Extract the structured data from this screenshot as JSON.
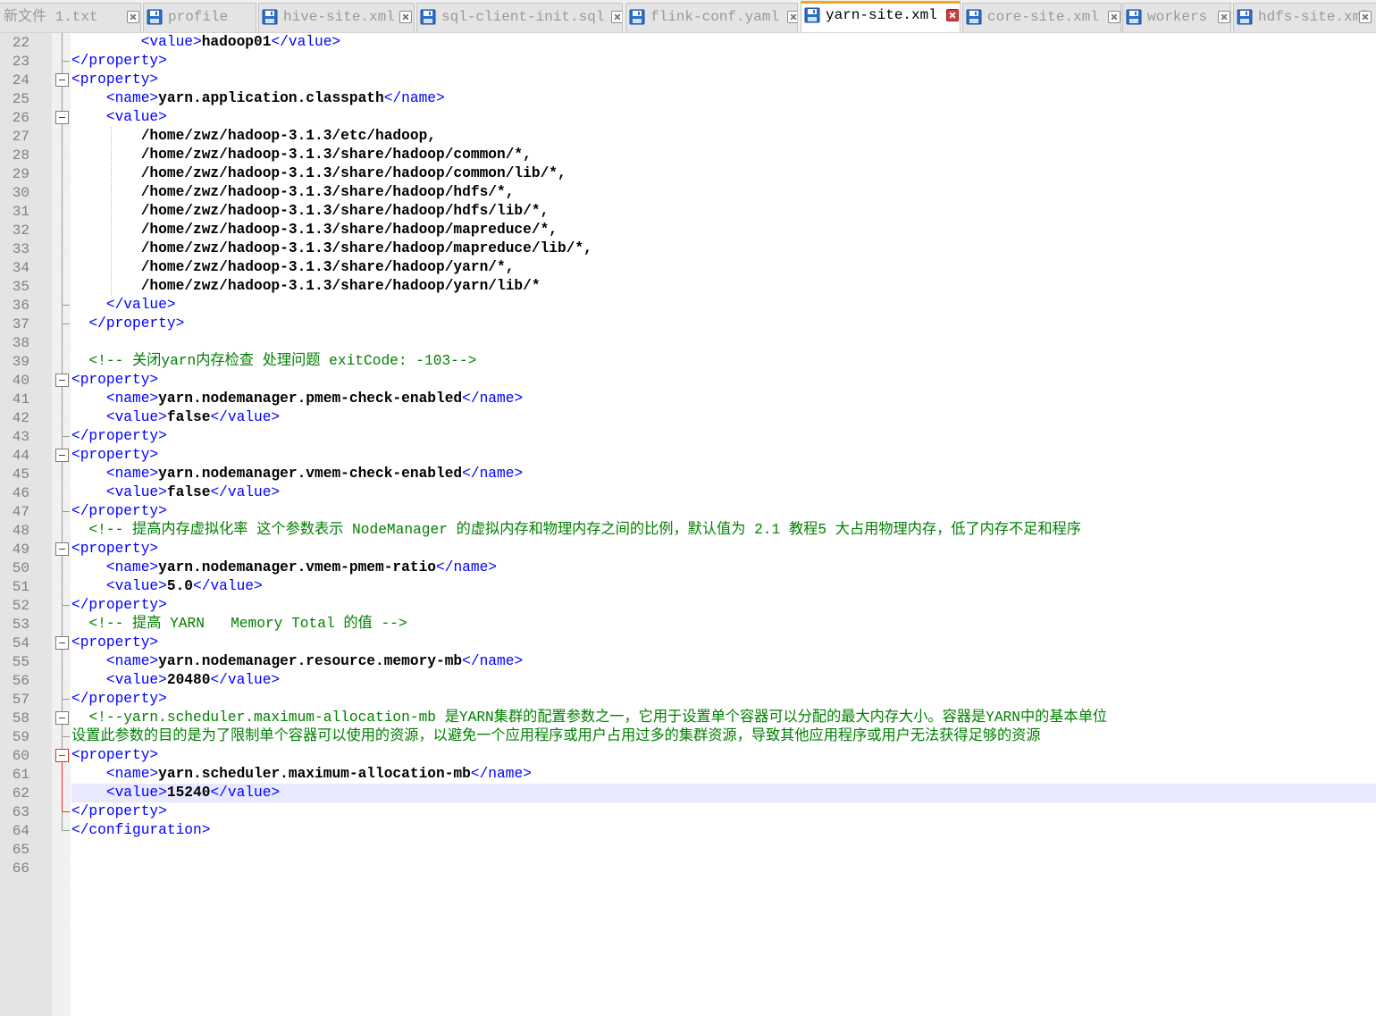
{
  "tabs": [
    {
      "label": "新文件 1.txt",
      "active": false,
      "icon": "save-disk-icon"
    },
    {
      "label": "profile",
      "active": false,
      "icon": "save-disk-icon"
    },
    {
      "label": "hive-site.xml",
      "active": false,
      "icon": "save-disk-icon"
    },
    {
      "label": "sql-client-init.sql",
      "active": false,
      "icon": "save-disk-icon"
    },
    {
      "label": "flink-conf.yaml",
      "active": false,
      "icon": "save-disk-icon"
    },
    {
      "label": "yarn-site.xml",
      "active": true,
      "icon": "save-disk-icon"
    },
    {
      "label": "core-site.xml",
      "active": false,
      "icon": "save-disk-icon"
    },
    {
      "label": "workers",
      "active": false,
      "icon": "save-disk-icon"
    },
    {
      "label": "hdfs-site.xml",
      "active": false,
      "icon": "save-disk-icon"
    }
  ],
  "editor": {
    "current_line": 62,
    "colors": {
      "tag": "#0000ff",
      "value": "#000000",
      "comment": "#008000",
      "current_line_bg": "#e8e8ff"
    },
    "lines": [
      {
        "n": "22",
        "segs": [
          [
            "s",
            "        "
          ],
          [
            "t",
            "<value>"
          ],
          [
            "v",
            "hadoop01"
          ],
          [
            "t",
            "</value>"
          ]
        ]
      },
      {
        "n": "23",
        "segs": [
          [
            "t",
            "</property>"
          ]
        ]
      },
      {
        "n": "24",
        "segs": [
          [
            "t",
            "<property>"
          ]
        ]
      },
      {
        "n": "25",
        "segs": [
          [
            "s",
            "    "
          ],
          [
            "t",
            "<name>"
          ],
          [
            "v",
            "yarn.application.classpath"
          ],
          [
            "t",
            "</name>"
          ]
        ]
      },
      {
        "n": "26",
        "segs": [
          [
            "s",
            "    "
          ],
          [
            "t",
            "<value>"
          ]
        ]
      },
      {
        "n": "27",
        "segs": [
          [
            "s",
            "        "
          ],
          [
            "v",
            "/home/zwz/hadoop-3.1.3/etc/hadoop,"
          ]
        ]
      },
      {
        "n": "28",
        "segs": [
          [
            "s",
            "        "
          ],
          [
            "v",
            "/home/zwz/hadoop-3.1.3/share/hadoop/common/*,"
          ]
        ]
      },
      {
        "n": "29",
        "segs": [
          [
            "s",
            "        "
          ],
          [
            "v",
            "/home/zwz/hadoop-3.1.3/share/hadoop/common/lib/*,"
          ]
        ]
      },
      {
        "n": "30",
        "segs": [
          [
            "s",
            "        "
          ],
          [
            "v",
            "/home/zwz/hadoop-3.1.3/share/hadoop/hdfs/*,"
          ]
        ]
      },
      {
        "n": "31",
        "segs": [
          [
            "s",
            "        "
          ],
          [
            "v",
            "/home/zwz/hadoop-3.1.3/share/hadoop/hdfs/lib/*,"
          ]
        ]
      },
      {
        "n": "32",
        "segs": [
          [
            "s",
            "        "
          ],
          [
            "v",
            "/home/zwz/hadoop-3.1.3/share/hadoop/mapreduce/*,"
          ]
        ]
      },
      {
        "n": "33",
        "segs": [
          [
            "s",
            "        "
          ],
          [
            "v",
            "/home/zwz/hadoop-3.1.3/share/hadoop/mapreduce/lib/*,"
          ]
        ]
      },
      {
        "n": "34",
        "segs": [
          [
            "s",
            "        "
          ],
          [
            "v",
            "/home/zwz/hadoop-3.1.3/share/hadoop/yarn/*,"
          ]
        ]
      },
      {
        "n": "35",
        "segs": [
          [
            "s",
            "        "
          ],
          [
            "v",
            "/home/zwz/hadoop-3.1.3/share/hadoop/yarn/lib/*"
          ]
        ]
      },
      {
        "n": "36",
        "segs": [
          [
            "s",
            "    "
          ],
          [
            "t",
            "</value>"
          ]
        ]
      },
      {
        "n": "37",
        "segs": [
          [
            "s",
            "  "
          ],
          [
            "t",
            "</property>"
          ]
        ]
      },
      {
        "n": "38",
        "segs": []
      },
      {
        "n": "39",
        "segs": [
          [
            "s",
            "  "
          ],
          [
            "c",
            "<!-- 关闭yarn内存检查 处理问题 exitCode: -103-->"
          ]
        ]
      },
      {
        "n": "40",
        "segs": [
          [
            "t",
            "<property>"
          ]
        ]
      },
      {
        "n": "41",
        "segs": [
          [
            "s",
            "    "
          ],
          [
            "t",
            "<name>"
          ],
          [
            "v",
            "yarn.nodemanager.pmem-check-enabled"
          ],
          [
            "t",
            "</name>"
          ]
        ]
      },
      {
        "n": "42",
        "segs": [
          [
            "s",
            "    "
          ],
          [
            "t",
            "<value>"
          ],
          [
            "v",
            "false"
          ],
          [
            "t",
            "</value>"
          ]
        ]
      },
      {
        "n": "43",
        "segs": [
          [
            "t",
            "</property>"
          ]
        ]
      },
      {
        "n": "44",
        "segs": [
          [
            "t",
            "<property>"
          ]
        ]
      },
      {
        "n": "45",
        "segs": [
          [
            "s",
            "    "
          ],
          [
            "t",
            "<name>"
          ],
          [
            "v",
            "yarn.nodemanager.vmem-check-enabled"
          ],
          [
            "t",
            "</name>"
          ]
        ]
      },
      {
        "n": "46",
        "segs": [
          [
            "s",
            "    "
          ],
          [
            "t",
            "<value>"
          ],
          [
            "v",
            "false"
          ],
          [
            "t",
            "</value>"
          ]
        ]
      },
      {
        "n": "47",
        "segs": [
          [
            "t",
            "</property>"
          ]
        ]
      },
      {
        "n": "48",
        "segs": [
          [
            "s",
            "  "
          ],
          [
            "c",
            "<!-- 提高内存虚拟化率 这个参数表示 NodeManager 的虚拟内存和物理内存之间的比例，默认值为 2.1 教程5 大占用物理内存，低了内存不足和程序"
          ]
        ]
      },
      {
        "n": "49",
        "segs": [
          [
            "t",
            "<property>"
          ]
        ]
      },
      {
        "n": "50",
        "segs": [
          [
            "s",
            "    "
          ],
          [
            "t",
            "<name>"
          ],
          [
            "v",
            "yarn.nodemanager.vmem-pmem-ratio"
          ],
          [
            "t",
            "</name>"
          ]
        ]
      },
      {
        "n": "51",
        "segs": [
          [
            "s",
            "    "
          ],
          [
            "t",
            "<value>"
          ],
          [
            "v",
            "5.0"
          ],
          [
            "t",
            "</value>"
          ]
        ]
      },
      {
        "n": "52",
        "segs": [
          [
            "t",
            "</property>"
          ]
        ]
      },
      {
        "n": "53",
        "segs": [
          [
            "s",
            "  "
          ],
          [
            "c",
            "<!-- 提高 YARN   Memory Total 的值 -->"
          ]
        ]
      },
      {
        "n": "54",
        "segs": [
          [
            "t",
            "<property>"
          ]
        ]
      },
      {
        "n": "55",
        "segs": [
          [
            "s",
            "    "
          ],
          [
            "t",
            "<name>"
          ],
          [
            "v",
            "yarn.nodemanager.resource.memory-mb"
          ],
          [
            "t",
            "</name>"
          ]
        ]
      },
      {
        "n": "56",
        "segs": [
          [
            "s",
            "    "
          ],
          [
            "t",
            "<value>"
          ],
          [
            "v",
            "20480"
          ],
          [
            "t",
            "</value>"
          ]
        ]
      },
      {
        "n": "57",
        "segs": [
          [
            "t",
            "</property>"
          ]
        ]
      },
      {
        "n": "58",
        "segs": [
          [
            "s",
            "  "
          ],
          [
            "c",
            "<!--yarn.scheduler.maximum-allocation-mb 是YARN集群的配置参数之一，它用于设置单个容器可以分配的最大内存大小。容器是YARN中的基本单位"
          ]
        ]
      },
      {
        "n": "59",
        "segs": [
          [
            "c",
            "设置此参数的目的是为了限制单个容器可以使用的资源，以避免一个应用程序或用户占用过多的集群资源，导致其他应用程序或用户无法获得足够的资源"
          ]
        ]
      },
      {
        "n": "60",
        "segs": [
          [
            "t",
            "<property>"
          ]
        ]
      },
      {
        "n": "61",
        "segs": [
          [
            "s",
            "    "
          ],
          [
            "t",
            "<name>"
          ],
          [
            "v",
            "yarn.scheduler.maximum-allocation-mb"
          ],
          [
            "t",
            "</name>"
          ]
        ]
      },
      {
        "n": "62",
        "segs": [
          [
            "s",
            "    "
          ],
          [
            "t",
            "<value>"
          ],
          [
            "v",
            "15240"
          ],
          [
            "t",
            "</value>"
          ]
        ]
      },
      {
        "n": "63",
        "segs": [
          [
            "t",
            "</property>"
          ]
        ]
      },
      {
        "n": "64",
        "segs": [
          [
            "t",
            "</configuration>"
          ]
        ]
      },
      {
        "n": "65",
        "segs": []
      },
      {
        "n": "66",
        "segs": []
      }
    ]
  }
}
